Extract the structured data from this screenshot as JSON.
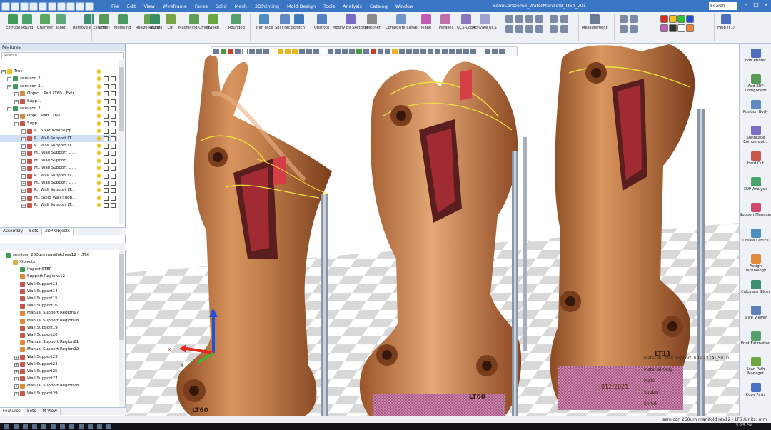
{
  "menubar": {
    "menus": [
      "File",
      "Edit",
      "View",
      "Wireframe",
      "Faces",
      "Solid",
      "Mesh",
      "3DPrinting",
      "Mold Design",
      "Tools",
      "Analysis",
      "Catalog",
      "Window"
    ],
    "doc_title": "SemiConDemo_WaferManifold_TI64_v01",
    "search_label": "Search"
  },
  "ribbon": {
    "buttons": [
      "Extrude",
      "Round",
      "Chamfer",
      "Taper",
      "Remove & Extend",
      "Offset",
      "Modeling",
      "Resize Rounds",
      "Scale",
      "Cut",
      "Machining Offset",
      "Sweep",
      "Rounded",
      "Trim Face",
      "Split Faces",
      "Stitch",
      "Unstitch",
      "Modify By Sketcher",
      "Sketcher",
      "Composite Curve",
      "Plane",
      "Parallel",
      "UCS Copy",
      "Activate UCS",
      "Measurement",
      "Help (F1)"
    ],
    "accent": "#3a76c4"
  },
  "features": {
    "title": "Features",
    "search_placeholder": "Search",
    "tree": [
      {
        "label": "Tray",
        "icon": "tray-icon"
      },
      {
        "label": "semicon 2...",
        "icon": "part-icon"
      },
      {
        "label": "semicon 2...",
        "icon": "part-icon"
      },
      {
        "label": "Objec...  Part LT60 - Extr..",
        "icon": "object-icon"
      },
      {
        "label": "Supp...",
        "icon": "support-icon"
      },
      {
        "label": "semicon 2...",
        "icon": "part-icon"
      },
      {
        "label": "Obje...  Part LT60",
        "icon": "object-icon"
      },
      {
        "label": "Supp...",
        "icon": "support-icon"
      },
      {
        "label": "R.. Solid Wall Supp...",
        "icon": "support-icon"
      },
      {
        "label": "R.. Wall Support LT...",
        "icon": "support-icon"
      },
      {
        "label": "R.. Wall Support LT...",
        "icon": "support-icon"
      },
      {
        "label": "M.. Wall Support LT...",
        "icon": "support-icon"
      },
      {
        "label": "M.. Wall Support LT...",
        "icon": "support-icon"
      },
      {
        "label": "M.. Wall Support LT...",
        "icon": "support-icon"
      },
      {
        "label": "R.. Wall Support LT...",
        "icon": "support-icon"
      },
      {
        "label": "M.. Wall Support LT...",
        "icon": "support-icon"
      },
      {
        "label": "R.. Wall Support LT...",
        "icon": "support-icon"
      },
      {
        "label": "M.. Solid Wall Supp...",
        "icon": "support-icon"
      },
      {
        "label": "R.. Wall Support LT...",
        "icon": "support-icon"
      }
    ],
    "tabs": [
      "Assembly",
      "Sets",
      "3DP Objects"
    ]
  },
  "objects": {
    "root": "semicon 250um manifold rev12 - LT60",
    "items": [
      "Objects",
      "Import STEP",
      "Support Regions12",
      "Wall Support13",
      "Wall Support14",
      "Wall Support15",
      "Wall Support16",
      "Manual Support Region17",
      "Manual Support Region18",
      "Wall Support19",
      "Wall Support20",
      "Manual Support Region21",
      "Manual Support Region22",
      "Wall Support23",
      "Wall Support24",
      "Wall Support25",
      "Wall Support27",
      "Manual Support Region28",
      "Wall Support29"
    ],
    "tabs": [
      "Features",
      "Sets",
      "M-View"
    ]
  },
  "viewport": {
    "axis_x": "X",
    "axis_y": "Y",
    "axis_z": "Z",
    "part_labels": [
      "LT60",
      "LT60",
      "LT11"
    ],
    "date_mark": "012/2021",
    "material_lines": [
      "Material:  Wall Support Ti Gr23 (A)_Sv10",
      "Material Only",
      "Parts",
      "Support",
      "Shrink"
    ]
  },
  "rightbar": {
    "items": [
      "Edit Printer",
      "Add 3DP Component",
      "Position Body",
      "Shrinkage Compensat...",
      "Hard Cut",
      "3DP Analysis",
      "Support Manager",
      "Create Lattice",
      "Assign Technology",
      "Calculate Slices",
      "Slice Viewer",
      "Print Estimation",
      "Scan-Path Manager",
      "Copy Parts"
    ]
  },
  "status": {
    "text": "semicon 250um manifold rev12 - LT6 /Units: mm",
    "clock": "5:25 PM"
  }
}
